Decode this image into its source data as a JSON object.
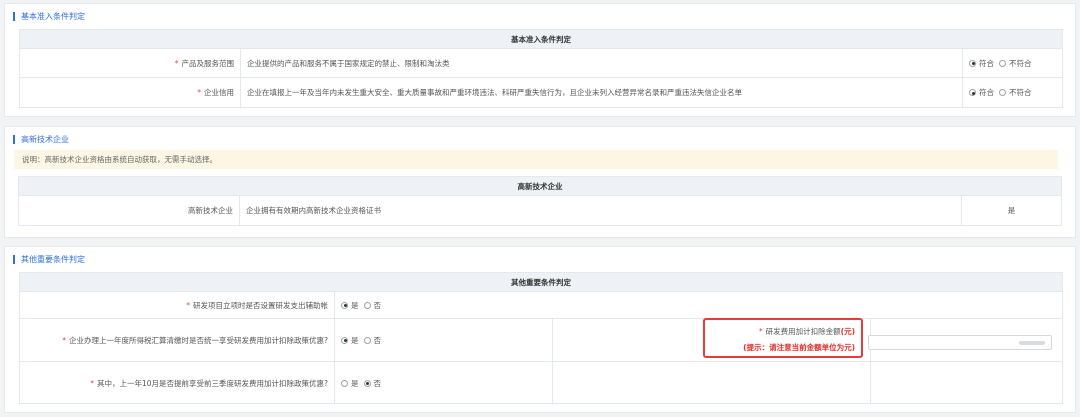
{
  "section1": {
    "title": "基本准入条件判定",
    "table_header": "基本准入条件判定",
    "rows": [
      {
        "label": "产品及服务范围",
        "desc": "企业提供的产品和服务不属于国家规定的禁止、限制和淘汰类",
        "selected": "符合"
      },
      {
        "label": "企业信用",
        "desc": "企业在填报上一年及当年内未发生重大安全、重大质量事故和严重环境违法、科研严重失信行为，且企业未列入经营异常名录和严重违法失信企业名单",
        "selected": "符合"
      }
    ],
    "options": [
      "符合",
      "不符合"
    ]
  },
  "section2": {
    "title": "高新技术企业",
    "notice": "说明：高新技术企业资格由系统自动获取，无需手动选择。",
    "table_header": "高新技术企业",
    "row": {
      "label": "高新技术企业",
      "desc": "企业拥有有效期内高新技术企业资格证书",
      "value": "是"
    }
  },
  "section3": {
    "title": "其他重要条件判定",
    "table_header": "其他重要条件判定",
    "options": [
      "是",
      "否"
    ],
    "rows": [
      {
        "label": "研发项目立项时是否设置研发支出辅助帐",
        "selected": "是"
      },
      {
        "label": "企业办理上一年度所得税汇算清缴时是否统一享受研发费用加计扣除政策优惠?",
        "selected": "是"
      },
      {
        "label": "其中，上一年10月是否提前享受前三季度研发费用加计扣除政策优惠?",
        "selected": "否"
      }
    ],
    "deduction": {
      "label": "研发费用加计扣除金额",
      "unit": "(元)",
      "hint": "(提示：请注意当前金额单位为元)"
    }
  }
}
